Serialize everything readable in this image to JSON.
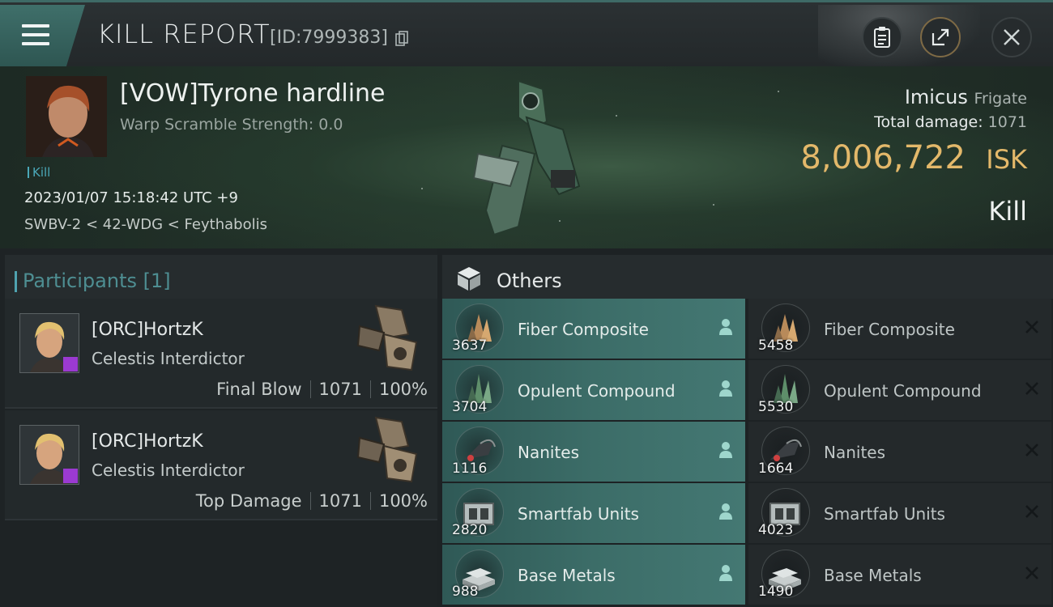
{
  "header": {
    "title": "KILL REPORT",
    "report_id": "[ID:7999383]",
    "buttons": [
      "clipboard-icon",
      "share-icon",
      "close-icon"
    ]
  },
  "victim": {
    "name": "[VOW]Tyrone hardline",
    "warp_scramble": "Warp Scramble Strength: 0.0",
    "tag": "Kill",
    "datetime": "2023/01/07 15:18:42 UTC +9",
    "location": "SWBV-2 < 42-WDG < Feythabolis",
    "ship_name": "Imicus",
    "ship_class": "Frigate",
    "total_damage_label": "Total damage:",
    "total_damage": "1071",
    "isk_value": "8,006,722",
    "isk_unit": "ISK",
    "result": "Kill"
  },
  "participants": {
    "title": "Participants",
    "count": "[1]",
    "rows": [
      {
        "name": "[ORC]HortzK",
        "ship": "Celestis Interdictor",
        "role": "Final Blow",
        "damage": "1071",
        "percent": "100%"
      },
      {
        "name": "[ORC]HortzK",
        "ship": "Celestis Interdictor",
        "role": "Top Damage",
        "damage": "1071",
        "percent": "100%"
      }
    ]
  },
  "others": {
    "title": "Others",
    "dropped": [
      {
        "name": "Fiber Composite",
        "qty": "3637",
        "icon": "fiber-composite-icon"
      },
      {
        "name": "Opulent Compound",
        "qty": "3704",
        "icon": "opulent-compound-icon"
      },
      {
        "name": "Nanites",
        "qty": "1116",
        "icon": "nanites-icon"
      },
      {
        "name": "Smartfab Units",
        "qty": "2820",
        "icon": "smartfab-units-icon"
      },
      {
        "name": "Base Metals",
        "qty": "988",
        "icon": "base-metals-icon"
      }
    ],
    "destroyed": [
      {
        "name": "Fiber Composite",
        "qty": "5458",
        "icon": "fiber-composite-icon"
      },
      {
        "name": "Opulent Compound",
        "qty": "5530",
        "icon": "opulent-compound-icon"
      },
      {
        "name": "Nanites",
        "qty": "1664",
        "icon": "nanites-icon"
      },
      {
        "name": "Smartfab Units",
        "qty": "4023",
        "icon": "smartfab-units-icon"
      },
      {
        "name": "Base Metals",
        "qty": "1490",
        "icon": "base-metals-icon"
      }
    ]
  },
  "colors": {
    "accent_teal": "#3f6f6a",
    "isk_gold": "#e3b86a",
    "dropped_bg": "#3c6d68",
    "corp_badge": "#9b3ad1"
  }
}
